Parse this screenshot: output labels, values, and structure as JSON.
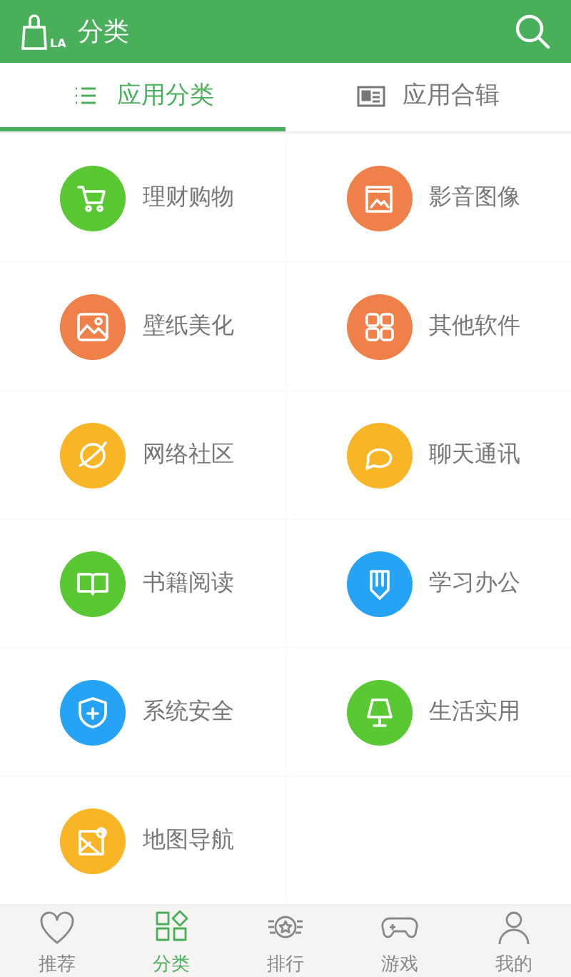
{
  "header": {
    "logo_text": "LA",
    "title": "分类"
  },
  "tabs": [
    {
      "label": "应用分类",
      "selected": true
    },
    {
      "label": "应用合辑",
      "selected": false
    }
  ],
  "categories": [
    {
      "label": "理财购物",
      "color": "#5ac832"
    },
    {
      "label": "影音图像",
      "color": "#f0804a"
    },
    {
      "label": "壁纸美化",
      "color": "#f0804a"
    },
    {
      "label": "其他软件",
      "color": "#f0804a"
    },
    {
      "label": "网络社区",
      "color": "#f8b526"
    },
    {
      "label": "聊天通讯",
      "color": "#f8b526"
    },
    {
      "label": "书籍阅读",
      "color": "#5ac832"
    },
    {
      "label": "学习办公",
      "color": "#27a3f5"
    },
    {
      "label": "系统安全",
      "color": "#27a3f5"
    },
    {
      "label": "生活实用",
      "color": "#5ac832"
    },
    {
      "label": "地图导航",
      "color": "#f8b526"
    }
  ],
  "bottom_nav": [
    {
      "label": "推荐",
      "selected": false
    },
    {
      "label": "分类",
      "selected": true
    },
    {
      "label": "排行",
      "selected": false
    },
    {
      "label": "游戏",
      "selected": false
    },
    {
      "label": "我的",
      "selected": false
    }
  ]
}
